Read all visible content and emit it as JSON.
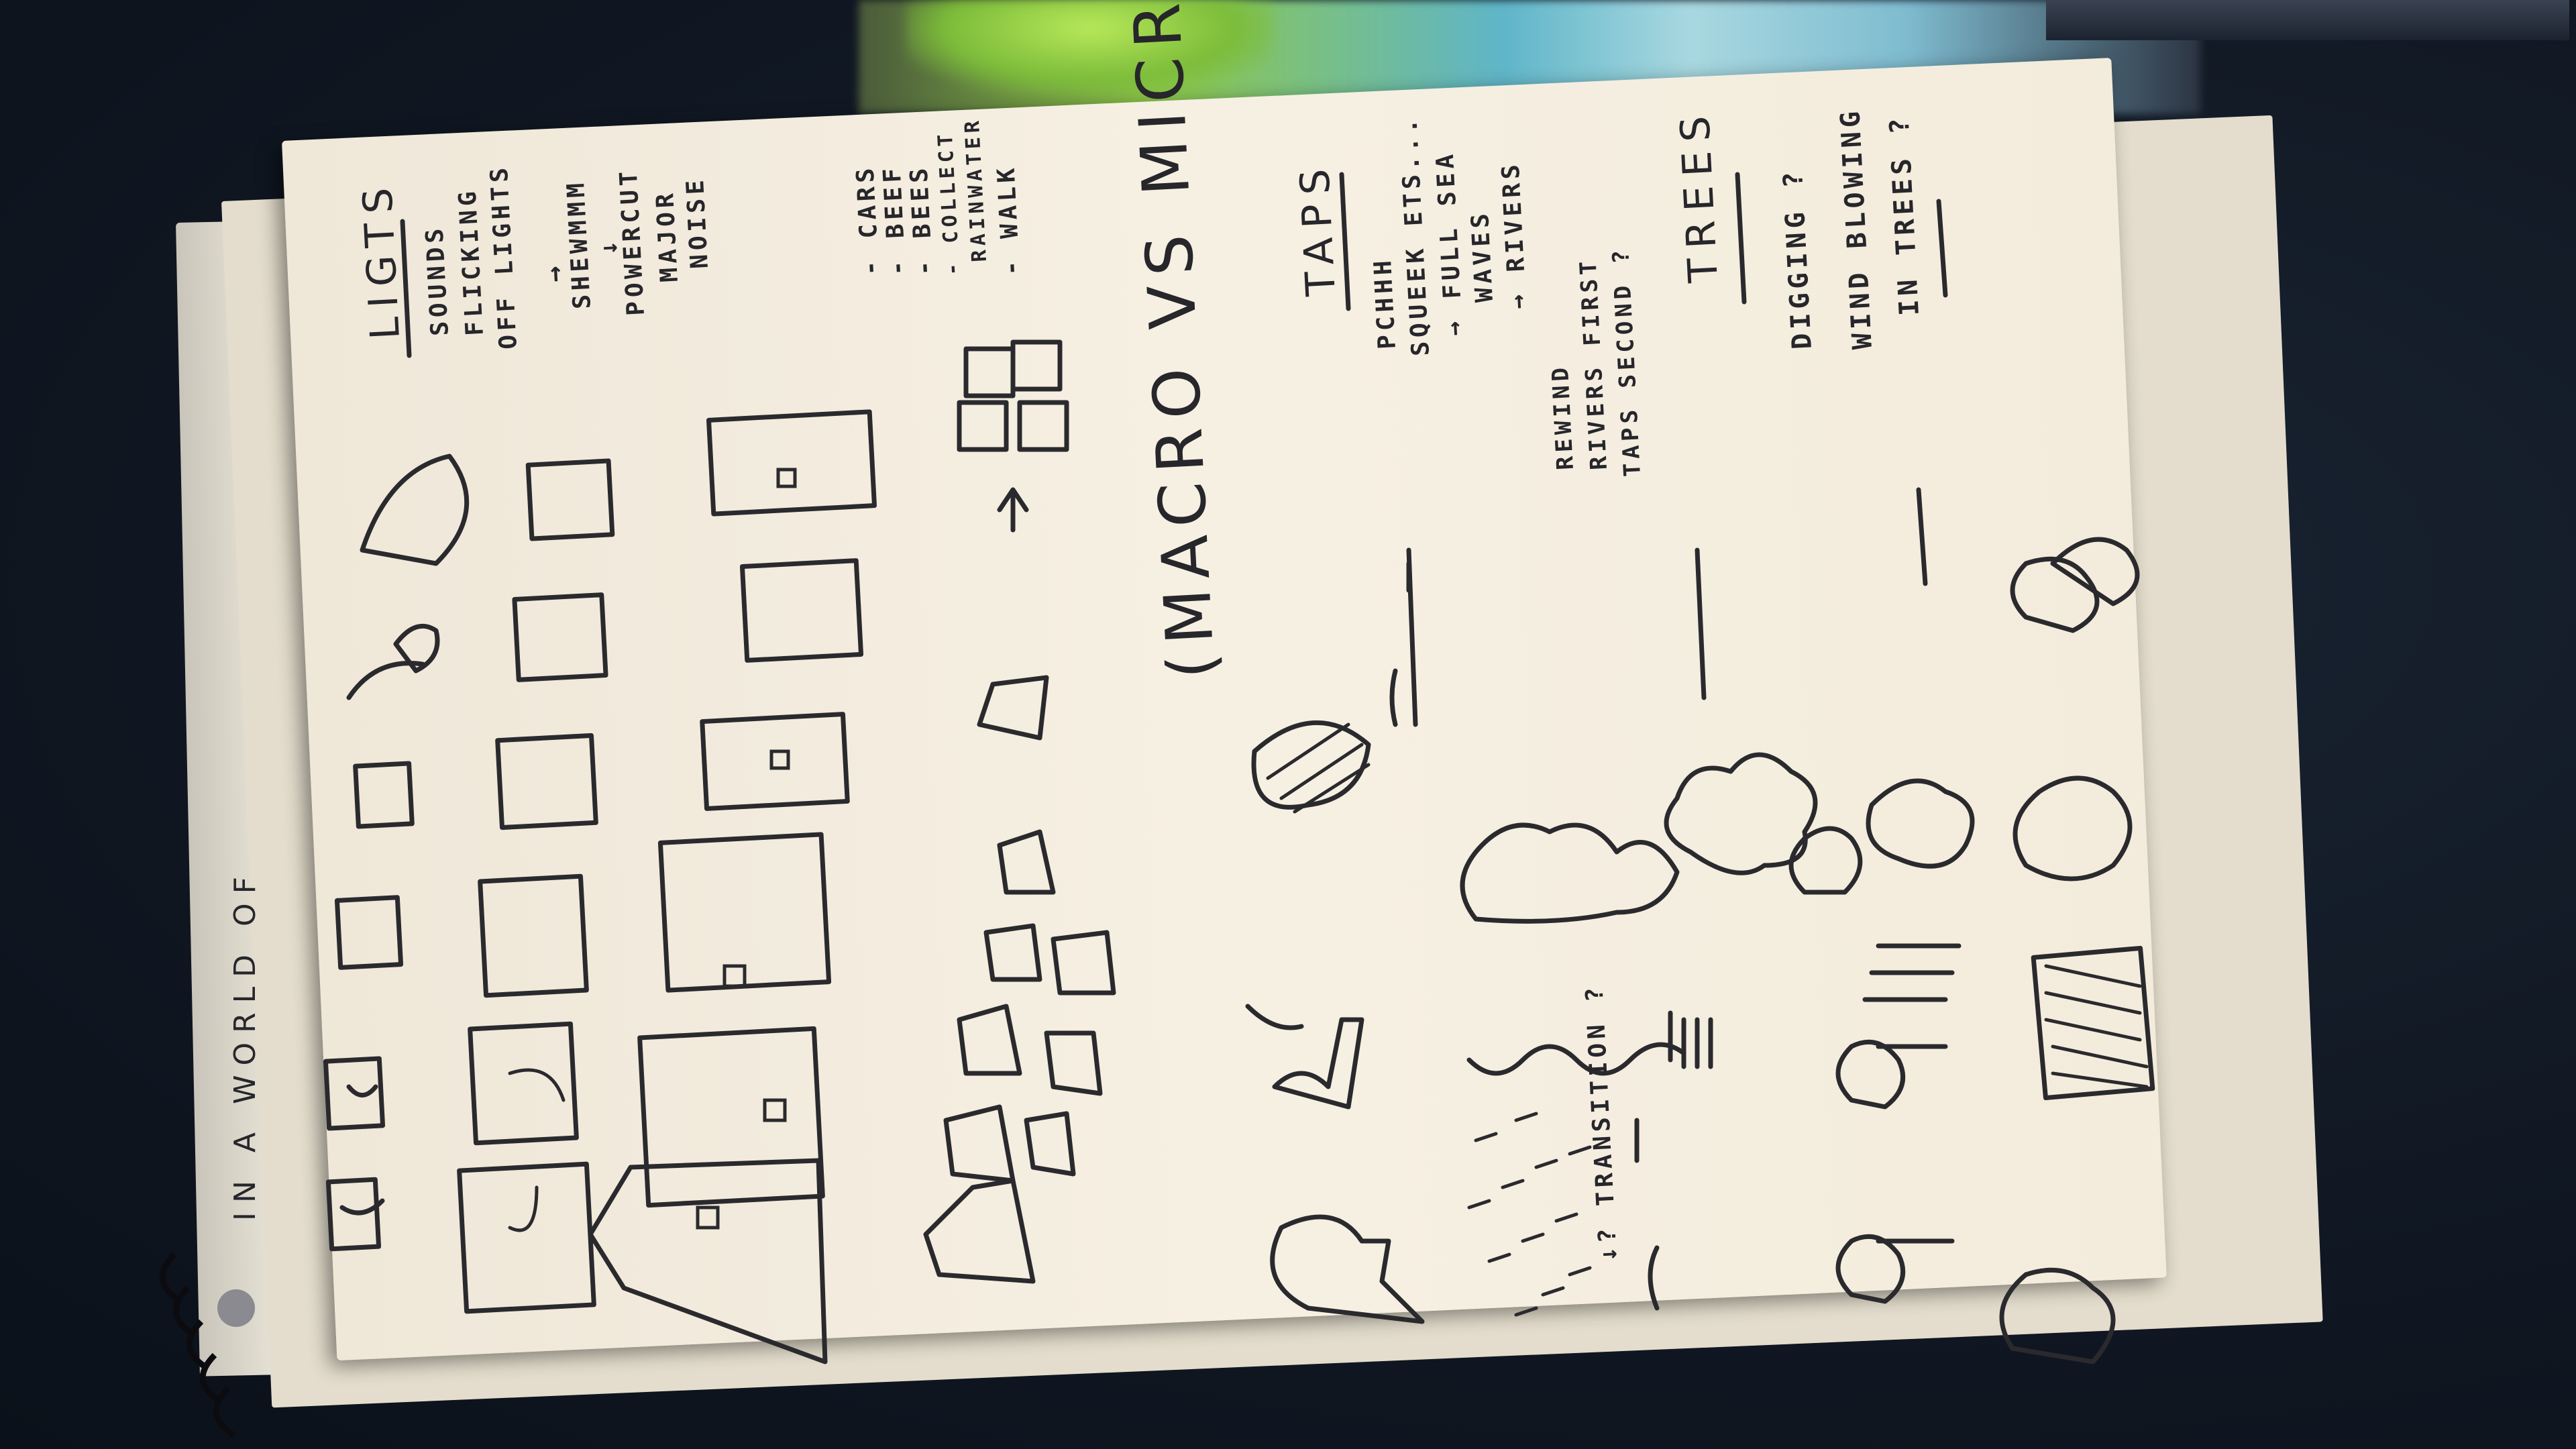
{
  "photo": {
    "subject": "open sketchbook page with hand-drawn doodles, photographed sideways on a dark fabric surface",
    "cover_text": "IN A WORLD OF",
    "headings": {
      "lights": "LIGTS",
      "taps": "TAPS",
      "trees": "TREES",
      "macro_micro": "(MACRO VS MICRO)"
    },
    "notes": {
      "lights": [
        "SOUNDS",
        "FLICKING",
        "OFF LIGHTS",
        "→",
        "SHEWMMM",
        "↓",
        "POWERCUT",
        "MAJOR",
        "NOISE"
      ],
      "list": [
        "- CARS",
        "- BEEF",
        "- BEES",
        "- COLLECT",
        "RAINWATER",
        "- WALK"
      ],
      "taps": [
        "PCHHH",
        "SQUEEK ETS...",
        "→ FULL SEA",
        "WAVES",
        "→ RIVERS",
        "REWIND",
        "RIVERS FIRST",
        "TAPS SECOND ?"
      ],
      "trees": [
        "DIGGING ?",
        "WIND BLOWING",
        "IN TREES ?"
      ],
      "transition": "↓? TRANSITION ?"
    }
  }
}
